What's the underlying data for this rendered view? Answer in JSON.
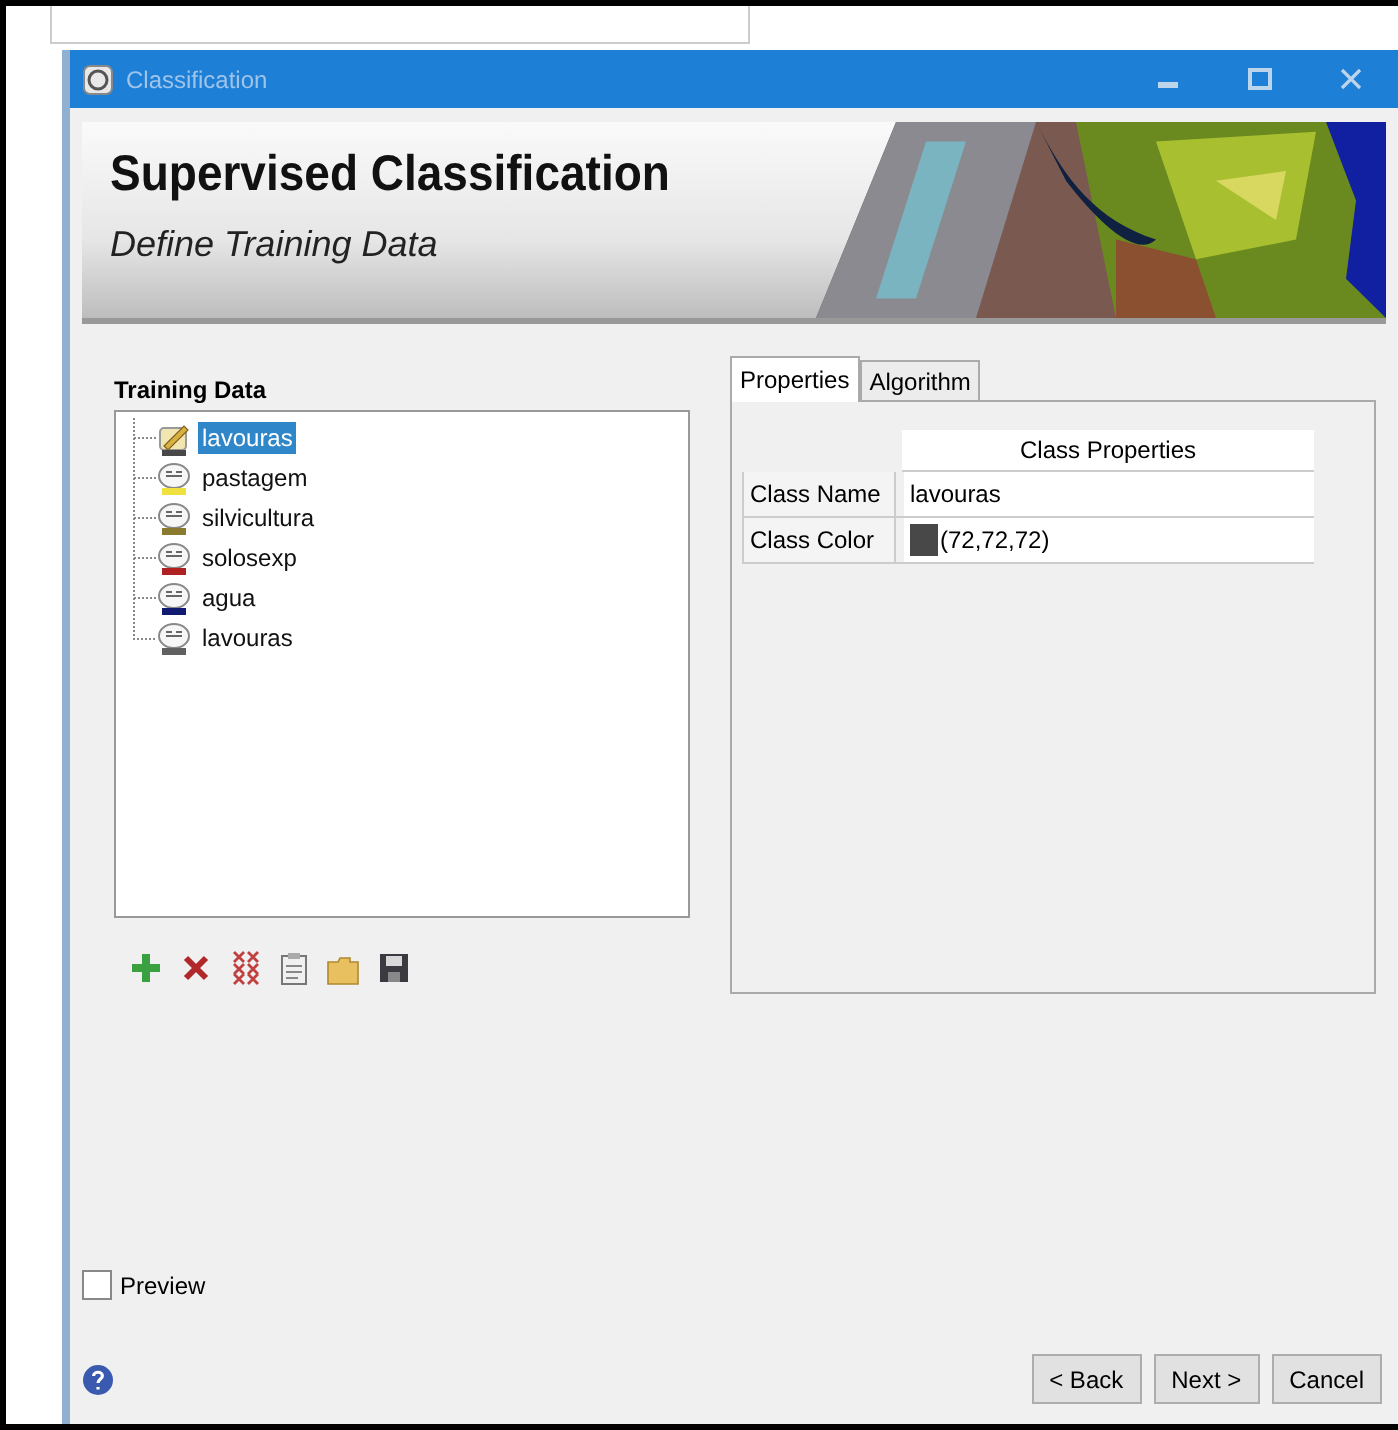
{
  "window": {
    "title": "Classification"
  },
  "header": {
    "title": "Supervised Classification",
    "subtitle": "Define Training Data"
  },
  "training_data": {
    "label": "Training Data",
    "items": [
      {
        "name": "lavouras",
        "kind": "edit",
        "selected": true,
        "color": "#484848"
      },
      {
        "name": "pastagem",
        "kind": "roi",
        "selected": false,
        "color": "#f0e040"
      },
      {
        "name": "silvicultura",
        "kind": "roi",
        "selected": false,
        "color": "#8a7a30"
      },
      {
        "name": "solosexp",
        "kind": "roi",
        "selected": false,
        "color": "#b02020"
      },
      {
        "name": "agua",
        "kind": "roi",
        "selected": false,
        "color": "#101a70"
      },
      {
        "name": "lavouras",
        "kind": "roi",
        "selected": false,
        "color": "#606060"
      }
    ]
  },
  "tabs": [
    {
      "label": "Properties",
      "selected": true
    },
    {
      "label": "Algorithm",
      "selected": false
    }
  ],
  "properties": {
    "heading": "Class Properties",
    "rows": [
      {
        "label": "Class Name",
        "value": "lavouras"
      },
      {
        "label": "Class Color",
        "value": "(72,72,72)",
        "color": "#484848"
      }
    ]
  },
  "preview": {
    "label": "Preview",
    "checked": false
  },
  "buttons": [
    "< Back",
    "Next >",
    "Cancel"
  ]
}
